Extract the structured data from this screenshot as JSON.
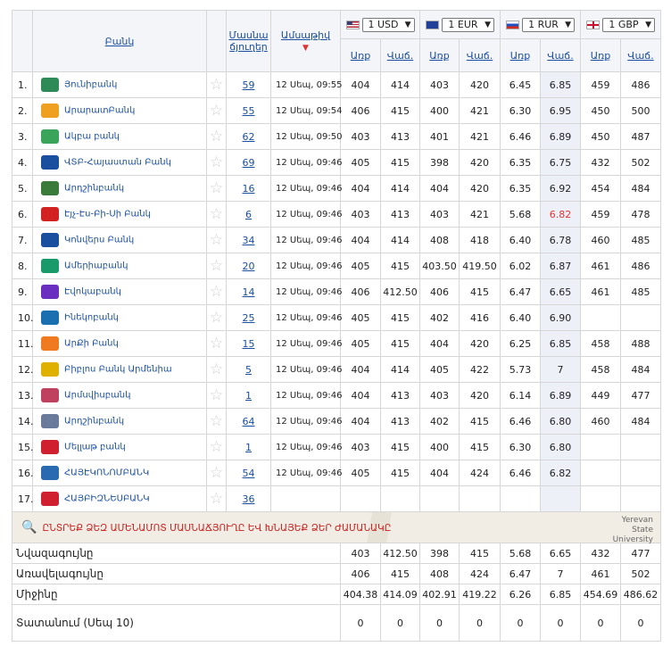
{
  "header": {
    "bank": "Բանկ",
    "branches": "Մասնա\nճյուղեր",
    "date": "Ամսաթիվ",
    "buy": "Առք",
    "sell": "Վաճ."
  },
  "currencies": [
    {
      "label": "1 USD",
      "icon": "us-flag-icon"
    },
    {
      "label": "1 EUR",
      "icon": "eu-flag-icon"
    },
    {
      "label": "1 RUR",
      "icon": "ru-flag-icon"
    },
    {
      "label": "1 GBP",
      "icon": "gb-flag-icon"
    }
  ],
  "rows": [
    {
      "n": "1.",
      "name": "Յունիբանկ",
      "br": "59",
      "time": "12 Սեպ, 09:55",
      "r": [
        "404",
        "414",
        "403",
        "420",
        "6.45",
        "6.85",
        "459",
        "486"
      ]
    },
    {
      "n": "2.",
      "name": "ԱրարատԲանկ",
      "br": "55",
      "time": "12 Սեպ, 09:54",
      "r": [
        "406",
        "415",
        "400",
        "421",
        "6.30",
        "6.95",
        "450",
        "500"
      ]
    },
    {
      "n": "3.",
      "name": "Ակբա բանկ",
      "br": "62",
      "time": "12 Սեպ, 09:50",
      "r": [
        "403",
        "413",
        "401",
        "421",
        "6.46",
        "6.89",
        "450",
        "487"
      ]
    },
    {
      "n": "4.",
      "name": "ՎՏԲ-Հայաստան Բանկ",
      "br": "69",
      "time": "12 Սեպ, 09:46",
      "r": [
        "405",
        "415",
        "398",
        "420",
        "6.35",
        "6.75",
        "432",
        "502"
      ]
    },
    {
      "n": "5.",
      "name": "Արդշինբանկ",
      "br": "16",
      "time": "12 Սեպ, 09:46",
      "r": [
        "404",
        "414",
        "404",
        "420",
        "6.35",
        "6.92",
        "454",
        "484"
      ]
    },
    {
      "n": "6.",
      "name": "Էյչ-Էս-Բի-Սի Բանկ",
      "br": "6",
      "time": "12 Սեպ, 09:46",
      "r": [
        "403",
        "413",
        "403",
        "421",
        "5.68",
        "6.82",
        "459",
        "478"
      ]
    },
    {
      "n": "7.",
      "name": "Կոնվերս Բանկ",
      "br": "34",
      "time": "12 Սեպ, 09:46",
      "r": [
        "404",
        "414",
        "408",
        "418",
        "6.40",
        "6.78",
        "460",
        "485"
      ]
    },
    {
      "n": "8.",
      "name": "Ամերիաբանկ",
      "br": "20",
      "time": "12 Սեպ, 09:46",
      "r": [
        "405",
        "415",
        "403.50",
        "419.50",
        "6.02",
        "6.87",
        "461",
        "486"
      ]
    },
    {
      "n": "9.",
      "name": "Էվոկաբանկ",
      "br": "14",
      "time": "12 Սեպ, 09:46",
      "r": [
        "406",
        "412.50",
        "406",
        "415",
        "6.47",
        "6.65",
        "461",
        "485"
      ]
    },
    {
      "n": "10.",
      "name": "Ինեկոբանկ",
      "br": "25",
      "time": "12 Սեպ, 09:46",
      "r": [
        "405",
        "415",
        "402",
        "416",
        "6.40",
        "6.90",
        "",
        ""
      ]
    },
    {
      "n": "11.",
      "name": "ԱրՔի Բանկ",
      "br": "15",
      "time": "12 Սեպ, 09:46",
      "r": [
        "405",
        "415",
        "404",
        "420",
        "6.25",
        "6.85",
        "458",
        "488"
      ]
    },
    {
      "n": "12.",
      "name": "Բիբլոս Բանկ Արմենիա",
      "br": "5",
      "time": "12 Սեպ, 09:46",
      "r": [
        "404",
        "414",
        "405",
        "422",
        "5.73",
        "7",
        "458",
        "484"
      ]
    },
    {
      "n": "13.",
      "name": "Արմսվիսբանկ",
      "br": "1",
      "time": "12 Սեպ, 09:46",
      "r": [
        "404",
        "413",
        "403",
        "420",
        "6.14",
        "6.89",
        "449",
        "477"
      ]
    },
    {
      "n": "14.",
      "name": "Արդշինբանկ",
      "br": "64",
      "time": "12 Սեպ, 09:46",
      "r": [
        "404",
        "413",
        "402",
        "415",
        "6.46",
        "6.80",
        "460",
        "484"
      ]
    },
    {
      "n": "15.",
      "name": "Մելլաթ բանկ",
      "br": "1",
      "time": "12 Սեպ, 09:46",
      "r": [
        "403",
        "415",
        "400",
        "415",
        "6.30",
        "6.80",
        "",
        ""
      ]
    },
    {
      "n": "16.",
      "name": "ՀԱՅԷԿՈՆՈՄԲԱՆԿ",
      "br": "54",
      "time": "12 Սեպ, 09:46",
      "r": [
        "405",
        "415",
        "404",
        "424",
        "6.46",
        "6.82",
        "",
        ""
      ]
    },
    {
      "n": "17.",
      "name": "ՀԱՅԲԻԶՆԵՍԲԱՆԿ",
      "br": "36",
      "time": "",
      "r": [
        "",
        "",
        "",
        "",
        "",
        "",
        "",
        ""
      ]
    }
  ],
  "logo_colors": [
    "#2e8b57",
    "#f0a020",
    "#3aa55a",
    "#1a4fa0",
    "#3a7a3a",
    "#d32020",
    "#1a4fa0",
    "#1a9a6a",
    "#6a2fc0",
    "#1a6fb0",
    "#f07a20",
    "#e0b000",
    "#c04060",
    "#6a7a9a",
    "#d02030",
    "#2a6ab0",
    "#d02030"
  ],
  "map": {
    "text": "ԸՆՏՐԵՔ ՁԵԶ ԱՄԵՆԱՄՈՏ ՄԱՍՆԱՃՅՈՒՂԸ ԵՎ ԽՆԱՅԵՔ ՁԵՐ ԺԱՄԱՆԱԿԸ",
    "place": "Yerevan State University"
  },
  "footer": [
    {
      "label": "Նվազագույնը",
      "v": [
        "403",
        "412.50",
        "398",
        "415",
        "5.68",
        "6.65",
        "432",
        "477"
      ]
    },
    {
      "label": "Առավելագույնը",
      "v": [
        "406",
        "415",
        "408",
        "424",
        "6.47",
        "7",
        "461",
        "502"
      ]
    },
    {
      "label": "Միջինը",
      "v": [
        "404.38",
        "414.09",
        "402.91",
        "419.22",
        "6.26",
        "6.85",
        "454.69",
        "486.62"
      ]
    },
    {
      "label": "Տատանում (Սեպ 10)",
      "v": [
        "0",
        "0",
        "0",
        "0",
        "0",
        "0",
        "0",
        "0"
      ]
    }
  ],
  "highlight": {
    "row": 5,
    "col": 5,
    "color": "#e53333"
  }
}
